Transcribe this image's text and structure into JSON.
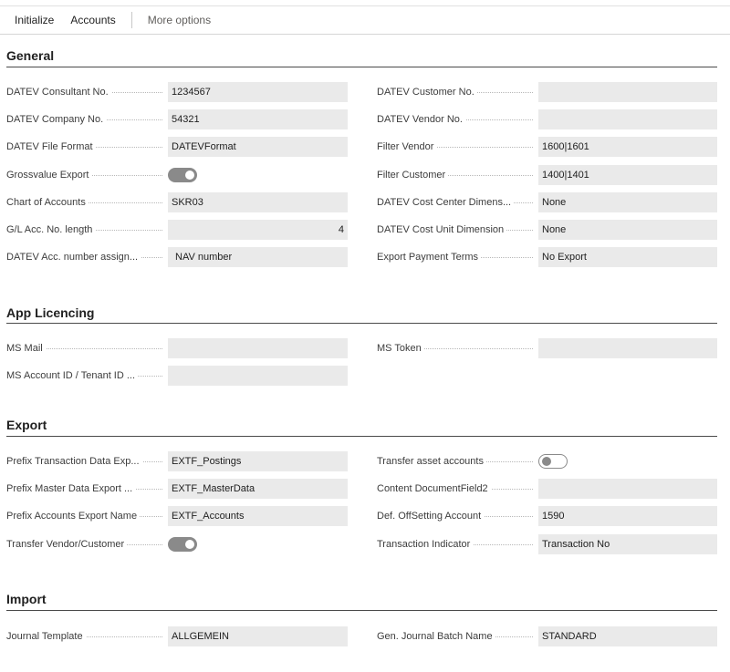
{
  "actionbar": {
    "initialize": "Initialize",
    "accounts": "Accounts",
    "more_options": "More options"
  },
  "general": {
    "title": "General",
    "left": [
      {
        "label": "DATEV Consultant No.",
        "value": "1234567"
      },
      {
        "label": "DATEV Company No.",
        "value": "54321"
      },
      {
        "label": "DATEV File Format",
        "value": "DATEVFormat"
      },
      {
        "label": "Grossvalue Export",
        "toggle": true
      },
      {
        "label": "Chart of Accounts",
        "value": "SKR03"
      },
      {
        "label": "G/L Acc. No. length",
        "value": "4"
      },
      {
        "label": "DATEV Acc. number assign...",
        "value": "NAV number"
      }
    ],
    "right": [
      {
        "label": "DATEV Customer No.",
        "value": ""
      },
      {
        "label": "DATEV Vendor No.",
        "value": ""
      },
      {
        "label": "Filter Vendor",
        "value": "1600|1601"
      },
      {
        "label": "Filter Customer",
        "value": "1400|1401"
      },
      {
        "label": "DATEV Cost Center Dimens...",
        "value": "None"
      },
      {
        "label": "DATEV Cost Unit Dimension",
        "value": "None"
      },
      {
        "label": "Export Payment Terms",
        "value": "No Export"
      }
    ]
  },
  "app_licencing": {
    "title": "App Licencing",
    "left": [
      {
        "label": "MS Mail",
        "value": ""
      },
      {
        "label": "MS Account ID / Tenant ID ...",
        "value": ""
      }
    ],
    "right": [
      {
        "label": "MS Token",
        "value": ""
      }
    ]
  },
  "export": {
    "title": "Export",
    "left": [
      {
        "label": "Prefix Transaction Data Exp...",
        "value": "EXTF_Postings"
      },
      {
        "label": "Prefix Master Data Export ...",
        "value": "EXTF_MasterData"
      },
      {
        "label": "Prefix Accounts Export Name",
        "value": "EXTF_Accounts"
      },
      {
        "label": "Transfer Vendor/Customer",
        "toggle": true
      }
    ],
    "right": [
      {
        "label": "Transfer asset accounts",
        "toggle": false
      },
      {
        "label": "Content DocumentField2",
        "value": ""
      },
      {
        "label": "Def. OffSetting Account",
        "value": "1590"
      },
      {
        "label": "Transaction Indicator",
        "value": "Transaction No"
      }
    ]
  },
  "import": {
    "title": "Import",
    "left": [
      {
        "label": "Journal Template",
        "value": "ALLGEMEIN"
      }
    ],
    "right": [
      {
        "label": "Gen. Journal Batch Name",
        "value": "STANDARD"
      }
    ]
  },
  "colors": {
    "field_bg": "#eaeaea",
    "section_rule": "#4a4a4a",
    "toggle": "#8a8a8a"
  }
}
